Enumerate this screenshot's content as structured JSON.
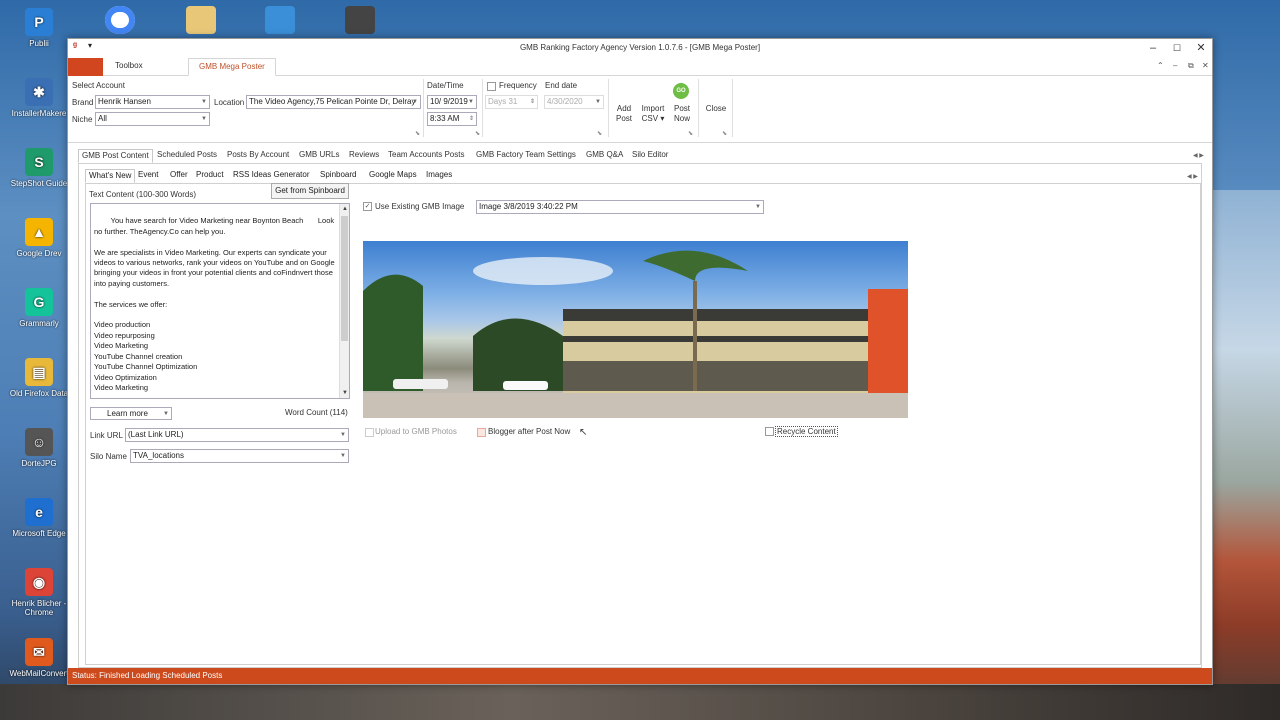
{
  "desktop": {
    "icons": [
      {
        "label": "Publii",
        "color": "#2a7fd4",
        "glyph": "P"
      },
      {
        "label": "InstallerMakere",
        "color": "#3b6fb3",
        "glyph": "✱"
      },
      {
        "label": "StepShot Guide",
        "color": "#1f9a6a",
        "glyph": "S"
      },
      {
        "label": "Google Drev",
        "color": "#f4b400",
        "glyph": "▲"
      },
      {
        "label": "Grammarly",
        "color": "#15c39a",
        "glyph": "G"
      },
      {
        "label": "Old Firefox Data",
        "color": "#e8b83a",
        "glyph": "▤"
      },
      {
        "label": "DorteJPG",
        "color": "#555",
        "glyph": "☺"
      },
      {
        "label": "Microsoft Edge",
        "color": "#1e6fd0",
        "glyph": "e"
      },
      {
        "label": "Henrik Blicher - Chrome",
        "color": "#db4437",
        "glyph": "◉"
      },
      {
        "label": "WebMailConvert",
        "color": "#e05a1e",
        "glyph": "✉"
      }
    ]
  },
  "window": {
    "title": "GMB Ranking Factory Agency Version 1.0.7.6 - [GMB Mega Poster]",
    "minimize": "–",
    "maximize": "☐",
    "close": "✕"
  },
  "ribbon_tabs": [
    "Toolbox",
    "GMB Mega Poster"
  ],
  "ribbon": {
    "select_account_label": "Select Account",
    "brand_label": "Brand",
    "brand_value": "Henrik Hansen",
    "niche_label": "Niche",
    "niche_value": "All",
    "location_label": "Location",
    "location_value": "The Video Agency,75 Pelican Pointe Dr, Delray",
    "datetime_label": "Date/Time",
    "date_value": "10/ 9/2019",
    "time_value": "8:33 AM",
    "frequency_label": "Frequency",
    "days_value": "Days 31",
    "end_date_label": "End date",
    "end_date_value": "4/30/2020",
    "add_post": "Add\nPost",
    "import_csv": "Import\nCSV ▾",
    "go_badge": "GO",
    "post_now": "Post\nNow",
    "close_label": "Close"
  },
  "doc_tabs": [
    "GMB Post Content",
    "Scheduled Posts",
    "Posts By Account",
    "GMB URLs",
    "Reviews",
    "Team Accounts Posts",
    "GMB Factory Team Settings",
    "GMB Q&A",
    "Silo Editor"
  ],
  "sub_tabs": [
    "What's New",
    "Event",
    "Offer",
    "Product",
    "RSS Ideas Generator",
    "Spinboard",
    "Google Maps",
    "Images"
  ],
  "post": {
    "text_content_label": "Text Content (100-300 Words)",
    "get_from_spinboard": "Get from Spinboard",
    "text": "You have search for Video Marketing near Boynton Beach       Look no further. TheAgency.Co can help you.\n\nWe are specialists in Video Marketing. Our experts can syndicate your videos to various networks, rank your videos on YouTube and on Google bringing your videos in front your potential clients and coFindnvert those into paying customers.\n\nThe services we offer:\n\nVideo production\nVideo repurposing\nVideo Marketing\nYouTube Channel creation\nYouTube Channel Optimization\nVideo Optimization\nVideo Marketing",
    "cta_value": "Learn more",
    "word_count": "Word Count (114)",
    "link_url_label": "Link URL",
    "link_url_value": "(Last Link URL)",
    "silo_name_label": "Silo Name",
    "silo_name_value": "TVA_locations",
    "use_existing_label": "Use Existing GMB Image",
    "image_select_value": "Image 3/8/2019 3:40:22 PM",
    "upload_label": "Upload to GMB Photos",
    "blogger_label": "Blogger after Post Now",
    "recycle_label": "Recycle Content"
  },
  "status": "Status: Finished Loading Scheduled Posts",
  "colors": {
    "accent": "#cc4a1c",
    "tab_active_text": "#c0502a"
  }
}
